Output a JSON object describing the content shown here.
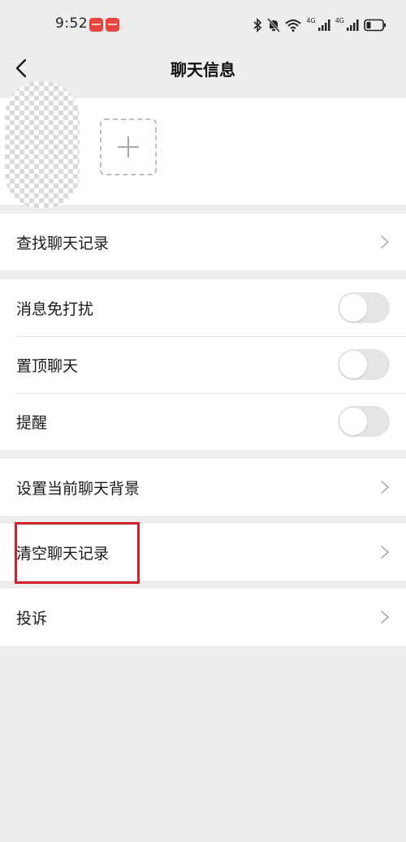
{
  "status_bar": {
    "time": "9:52",
    "network_1": "4G",
    "network_2": "4G",
    "icons": [
      "bluetooth-icon",
      "mute-icon",
      "wifi-icon",
      "signal-icon",
      "signal-icon",
      "battery-icon"
    ]
  },
  "nav": {
    "title": "聊天信息",
    "back_icon": "chevron-left-icon"
  },
  "members": {
    "add_icon": "plus-icon"
  },
  "rows": {
    "search_history": "查找聊天记录",
    "mute": "消息免打扰",
    "pin": "置顶聊天",
    "remind": "提醒",
    "set_background": "设置当前聊天背景",
    "clear_history": "清空聊天记录",
    "complain": "投诉"
  },
  "toggles": {
    "mute": false,
    "pin": false,
    "remind": false
  },
  "colors": {
    "background": "#ededed",
    "highlight": "#d0202a",
    "toggle_off": "#e5e5e5"
  }
}
